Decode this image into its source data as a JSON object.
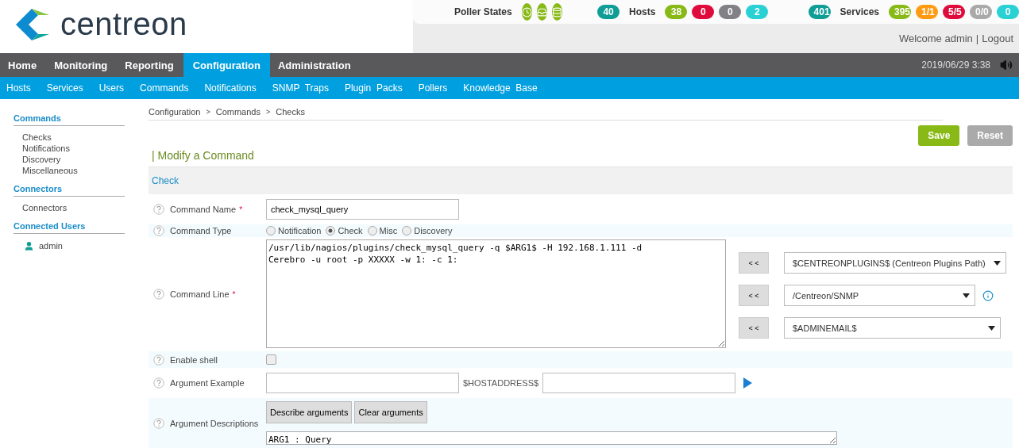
{
  "header": {
    "logo_text": "centreon",
    "poller_states": {
      "label": "Poller States",
      "icons": [
        {
          "kind": "clock"
        },
        {
          "kind": "inbox"
        },
        {
          "kind": "database"
        }
      ]
    },
    "hosts": {
      "total": "40",
      "label": "Hosts",
      "counts": [
        {
          "value": "38",
          "color": "#88b917"
        },
        {
          "value": "0",
          "color": "#e00b3d"
        },
        {
          "value": "0",
          "color": "#818185"
        },
        {
          "value": "2",
          "color": "#2ad1d4"
        }
      ]
    },
    "services": {
      "total": "401",
      "label": "Services",
      "counts": [
        {
          "value": "395",
          "color": "#88b917"
        },
        {
          "value": "1/1",
          "color": "#ff9a13"
        },
        {
          "value": "5/5",
          "color": "#e00b3d"
        },
        {
          "value": "0/0",
          "color": "#a9a9a9"
        },
        {
          "value": "0",
          "color": "#2ad1d4"
        }
      ]
    },
    "user_links": {
      "welcome": "Welcome admin",
      "separator": "|",
      "logout": "Logout"
    }
  },
  "menu": [
    {
      "label": "Home",
      "selected": false
    },
    {
      "label": "Monitoring",
      "selected": false
    },
    {
      "label": "Reporting",
      "selected": false
    },
    {
      "label": "Configuration",
      "selected": true
    },
    {
      "label": "Administration",
      "selected": false
    }
  ],
  "datetime": "2019/06/29 3:38",
  "submenu": [
    "Hosts",
    "Services",
    "Users",
    "Commands",
    "Notifications",
    "SNMP  Traps",
    "Plugin  Packs",
    "Pollers",
    "Knowledge  Base"
  ],
  "sidebar": [
    {
      "title": "Commands",
      "items": [
        {
          "label": "Checks",
          "kind": "link"
        },
        {
          "label": "Notifications",
          "kind": "link"
        },
        {
          "label": "Discovery",
          "kind": "link"
        },
        {
          "label": "Miscellaneous",
          "kind": "link"
        }
      ]
    },
    {
      "title": "Connectors",
      "items": [
        {
          "label": "Connectors",
          "kind": "link"
        }
      ]
    },
    {
      "title": "Connected Users",
      "items": [
        {
          "label": "admin",
          "kind": "user"
        }
      ]
    }
  ],
  "breadcrumb": [
    "Configuration",
    ">",
    "Commands",
    ">",
    "Checks"
  ],
  "buttons": [
    {
      "label": "Save",
      "disabled": false
    },
    {
      "label": "Reset",
      "disabled": true
    }
  ],
  "page_title": "| Modify a Command",
  "section_tab": "Check",
  "form": [
    {
      "kind": "text",
      "label": "Command Name",
      "required_mark": "*",
      "value": "check_mysql_query"
    },
    {
      "kind": "radio",
      "label": "Command Type",
      "options": [
        {
          "label": "Notification",
          "selected": false
        },
        {
          "label": "Check",
          "selected": true
        },
        {
          "label": "Misc",
          "selected": false
        },
        {
          "label": "Discovery",
          "selected": false
        }
      ]
    },
    {
      "kind": "command_line",
      "label": "Command Line",
      "required_mark": "*",
      "value": "/usr/lib/nagios/plugins/check_mysql_query -q $ARG1$ -H 192.168.1.111 -d\nCerebro -u root -p XXXXX -w 1: -c 1:",
      "macros": [
        {
          "button": "< <",
          "value": "$CENTREONPLUGINS$ (Centreon Plugins Path)",
          "info": false
        },
        {
          "button": "< <",
          "value": "/Centreon/SNMP",
          "info": true
        },
        {
          "button": "< <",
          "value": "$ADMINEMAIL$",
          "info": false
        }
      ]
    },
    {
      "kind": "checkbox",
      "label": "Enable shell",
      "checked": false
    },
    {
      "kind": "argument_example",
      "label": "Argument Example",
      "middle": "$HOSTADDRESS$"
    },
    {
      "kind": "argument_descriptions",
      "label": "Argument Descriptions",
      "buttons": [
        "Describe arguments",
        "Clear arguments"
      ],
      "value": "ARG1 : Query"
    }
  ]
}
